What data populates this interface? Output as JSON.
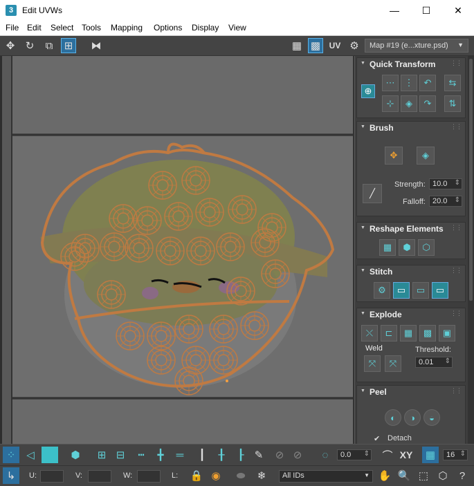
{
  "window": {
    "app_icon": "3",
    "title": "Edit UVWs",
    "minimize": "—",
    "maximize": "☐",
    "close": "✕"
  },
  "menu": [
    "File",
    "Edit",
    "Select",
    "Tools",
    "Mapping",
    "Options",
    "Display",
    "View"
  ],
  "toolbar": {
    "uv_label": "UV",
    "map_select": "Map #19 (e...xture.psd)"
  },
  "quick_transform": {
    "title": "Quick Transform"
  },
  "brush": {
    "title": "Brush",
    "strength_label": "Strength:",
    "strength_value": "10.0",
    "falloff_label": "Falloff:",
    "falloff_value": "20.0"
  },
  "reshape": {
    "title": "Reshape Elements"
  },
  "stitch": {
    "title": "Stitch"
  },
  "explode": {
    "title": "Explode",
    "weld_label": "Weld",
    "threshold_label": "Threshold:",
    "threshold_value": "0.01"
  },
  "peel": {
    "title": "Peel",
    "detach_label": "Detach"
  },
  "bottom": {
    "rotation_value": "0.0",
    "xy_label": "XY",
    "grid_value": "16",
    "u_label": "U:",
    "v_label": "V:",
    "w_label": "W:",
    "l_label": "L:",
    "ids_select": "All IDs"
  }
}
